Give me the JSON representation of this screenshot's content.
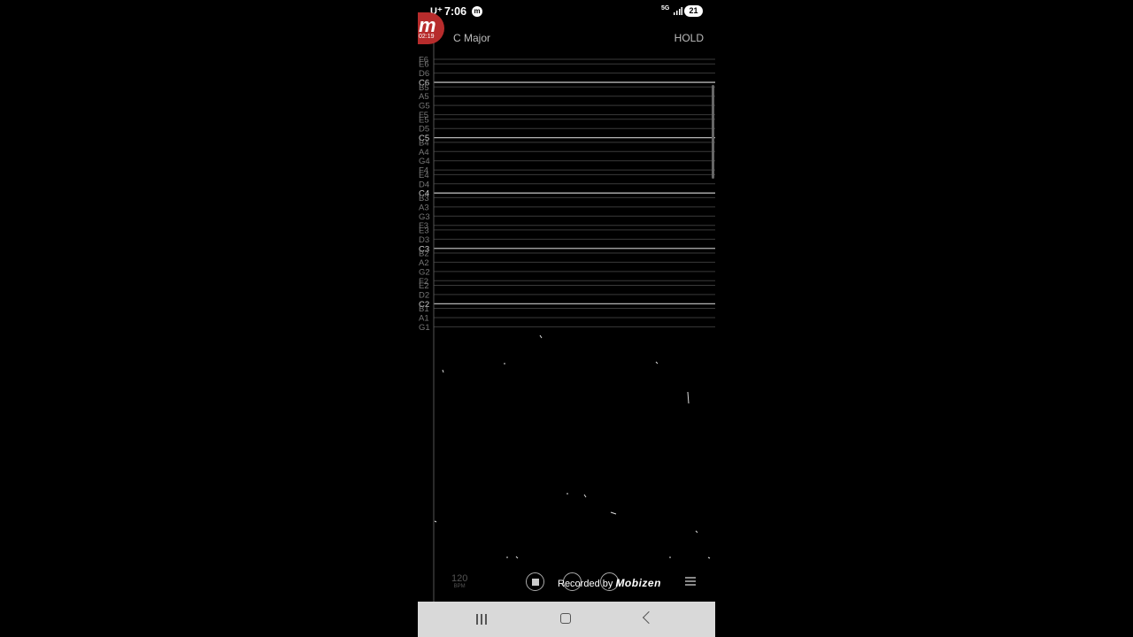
{
  "status_bar": {
    "carrier": "U⁺",
    "time": "7:06",
    "app_badge": "m",
    "data_indicator": "5G",
    "battery": "21"
  },
  "recorder_badge": {
    "logo": "m",
    "elapsed": "02:19"
  },
  "header": {
    "key": "C Major",
    "mode": "HOLD"
  },
  "note_labels": [
    "F6",
    "E6",
    "D6",
    "C6",
    "B5",
    "A5",
    "G5",
    "F5",
    "E5",
    "D5",
    "C5",
    "B4",
    "A4",
    "G4",
    "F4",
    "E4",
    "D4",
    "C4",
    "B3",
    "A3",
    "G3",
    "F3",
    "E3",
    "D3",
    "C3",
    "B2",
    "A2",
    "G2",
    "F2",
    "E2",
    "D2",
    "C2",
    "B1",
    "A1",
    "G1"
  ],
  "tempo": {
    "value": "120",
    "unit": "BPM"
  },
  "recording": {
    "label": "Recorded by",
    "brand": "Mobizen"
  },
  "colors": {
    "badge": "#b72c2c",
    "navbar": "#d9d9d9",
    "background": "#000000"
  },
  "icons": {
    "nav": [
      "recents-icon",
      "home-icon",
      "back-icon"
    ]
  }
}
